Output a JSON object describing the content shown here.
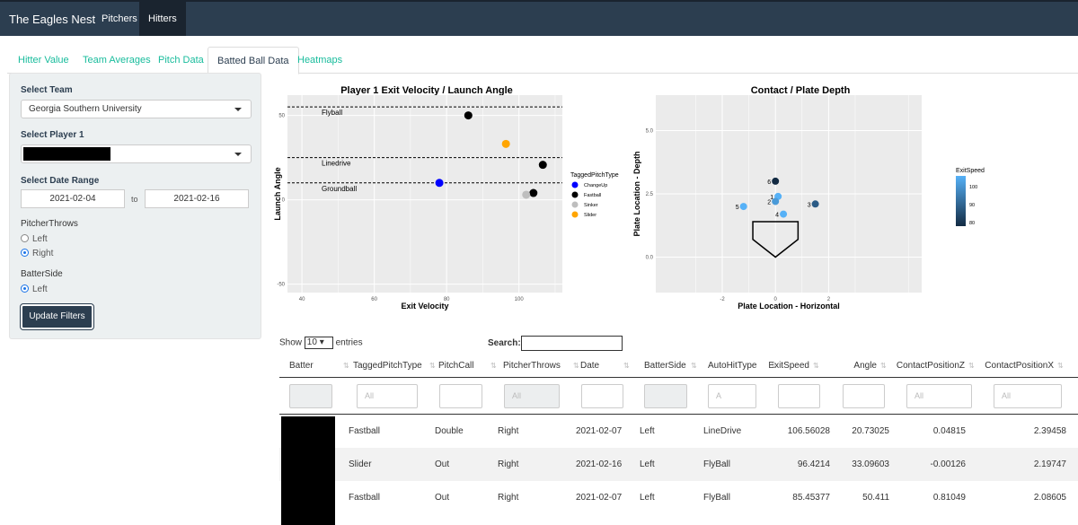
{
  "navbar": {
    "brand": "The Eagles Nest",
    "items": [
      "Pitchers",
      "Hitters"
    ],
    "active": 1
  },
  "tabs": [
    "Hitter Value",
    "Team Averages",
    "Pitch Data",
    "Batted Ball Data",
    "Heatmaps"
  ],
  "active_tab": 3,
  "sidebar": {
    "team_label": "Select Team",
    "team_value": "Georgia Southern University",
    "player_label": "Select Player 1",
    "date_label": "Select Date Range",
    "date_from": "2021-02-04",
    "date_to_sep": "to",
    "date_to": "2021-02-16",
    "throws_label": "PitcherThrows",
    "throws_options": [
      "Left",
      "Right"
    ],
    "throws_selected": "Right",
    "side_label": "BatterSide",
    "side_options": [
      "Left"
    ],
    "side_selected": "Left",
    "update_button": "Update Filters"
  },
  "colors": {
    "ChangeUp": "#0000ff",
    "Fastball": "#000000",
    "Sinker": "#bebebe",
    "Slider": "#ffa500"
  },
  "chart_data": [
    {
      "type": "scatter",
      "title": "Player 1 Exit Velocity / Launch Angle",
      "xlabel": "Exit Velocity",
      "ylabel": "Launch Angle",
      "xlim": [
        36,
        112
      ],
      "ylim": [
        -55,
        62
      ],
      "xticks": [
        40,
        60,
        80,
        100
      ],
      "yticks": [
        -50,
        0,
        50
      ],
      "hlines": [
        {
          "y": 55,
          "label": "Flyball"
        },
        {
          "y": 25,
          "label": "Linedrive"
        },
        {
          "y": 10,
          "label": "Groundball"
        }
      ],
      "legend_title": "TaggedPitchType",
      "legend": [
        "ChangeUp",
        "Fastball",
        "Sinker",
        "Slider"
      ],
      "points": [
        {
          "x": 86,
          "y": 50,
          "cat": "Fastball"
        },
        {
          "x": 96.4,
          "y": 33.1,
          "cat": "Slider"
        },
        {
          "x": 106.6,
          "y": 20.7,
          "cat": "Fastball"
        },
        {
          "x": 78,
          "y": 10,
          "cat": "ChangeUp"
        },
        {
          "x": 104,
          "y": 4,
          "cat": "Fastball"
        },
        {
          "x": 102,
          "y": 3,
          "cat": "Sinker"
        }
      ]
    },
    {
      "type": "scatter",
      "title": "Contact / Plate Depth",
      "xlabel": "Plate Location - Horizontal",
      "ylabel": "Plate Location - Depth",
      "xlim": [
        -4.5,
        5.5
      ],
      "ylim": [
        -1.4,
        6.4
      ],
      "xticks": [
        -2,
        0,
        2
      ],
      "yticks": [
        0.0,
        2.5,
        5.0
      ],
      "legend_title": "ExitSpeed",
      "legend_ticks": [
        100,
        90,
        80
      ],
      "points": [
        {
          "label": "6",
          "x": 0,
          "y": 3.0
        },
        {
          "label": "1",
          "x": 0.1,
          "y": 2.4
        },
        {
          "label": "2",
          "x": 0,
          "y": 2.2
        },
        {
          "label": "3",
          "x": 1.5,
          "y": 2.1
        },
        {
          "label": "5",
          "x": -1.2,
          "y": 2.0
        },
        {
          "label": "4",
          "x": 0.3,
          "y": 1.7
        }
      ]
    }
  ],
  "table": {
    "show_prefix": "Show",
    "length_value": "10",
    "show_suffix": "entries",
    "search_label": "Search:",
    "columns": [
      "Batter",
      "TaggedPitchType",
      "PitchCall",
      "PitcherThrows",
      "Date",
      "BatterSide",
      "AutoHitType",
      "ExitSpeed",
      "Angle",
      "ContactPositionZ",
      "ContactPositionX"
    ],
    "filters": [
      "",
      "All",
      "",
      "All",
      "",
      "",
      "A",
      "",
      "",
      "All",
      "All"
    ],
    "rows": [
      [
        "",
        "Fastball",
        "Double",
        "Right",
        "2021-02-07",
        "Left",
        "LineDrive",
        "106.56028",
        "20.73025",
        "0.04815",
        "2.39458"
      ],
      [
        "",
        "Slider",
        "Out",
        "Right",
        "2021-02-16",
        "Left",
        "FlyBall",
        "96.4214",
        "33.09603",
        "-0.00126",
        "2.19747"
      ],
      [
        "",
        "Fastball",
        "Out",
        "Right",
        "2021-02-07",
        "Left",
        "FlyBall",
        "85.45377",
        "50.411",
        "0.81049",
        "2.08605"
      ]
    ]
  }
}
